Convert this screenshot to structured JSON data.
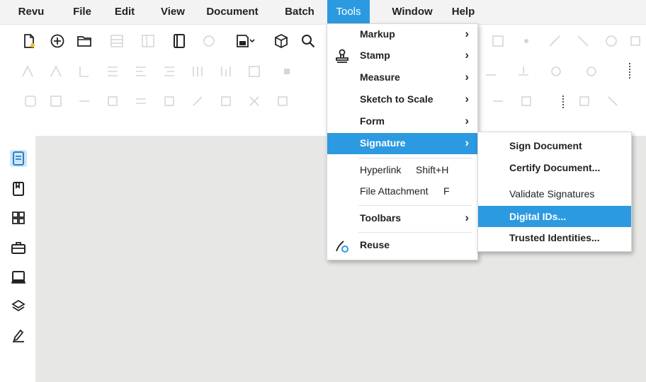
{
  "menubar": {
    "items": [
      "Revu",
      "File",
      "Edit",
      "View",
      "Document",
      "Batch",
      "Tools",
      "Window",
      "Help"
    ]
  },
  "tools_menu": {
    "items": [
      {
        "label": "Markup",
        "submenu": true
      },
      {
        "label": "Stamp",
        "submenu": true
      },
      {
        "label": "Measure",
        "submenu": true
      },
      {
        "label": "Sketch to Scale",
        "submenu": true
      },
      {
        "label": "Form",
        "submenu": true
      },
      {
        "label": "Signature",
        "submenu": true,
        "selected": true
      },
      {
        "label": "Hyperlink",
        "shortcut": "Shift+H"
      },
      {
        "label": "File Attachment",
        "shortcut": "F"
      },
      {
        "label": "Toolbars",
        "submenu": true
      },
      {
        "label": "Reuse"
      }
    ],
    "arrow": "›"
  },
  "signature_submenu": {
    "items": [
      {
        "label": "Sign Document"
      },
      {
        "label": "Certify Document..."
      },
      {
        "label": "Validate Signatures"
      },
      {
        "label": "Digital IDs...",
        "selected": true
      },
      {
        "label": "Trusted Identities..."
      }
    ]
  },
  "toolbar_icons": [
    "new-document-icon",
    "add-circle-icon",
    "open-folder-icon",
    "book-icon",
    "save-as-icon",
    "package-icon",
    "search-icon"
  ],
  "left_panel_icons": [
    "thumbnails-icon",
    "bookmarks-icon",
    "grid-icon",
    "toolchest-icon",
    "library-icon",
    "layers-icon",
    "signatures-icon"
  ],
  "colors": {
    "accent": "#2c9ae0",
    "workspace": "#e7e7e5",
    "menubar": "#f3f3f3"
  }
}
